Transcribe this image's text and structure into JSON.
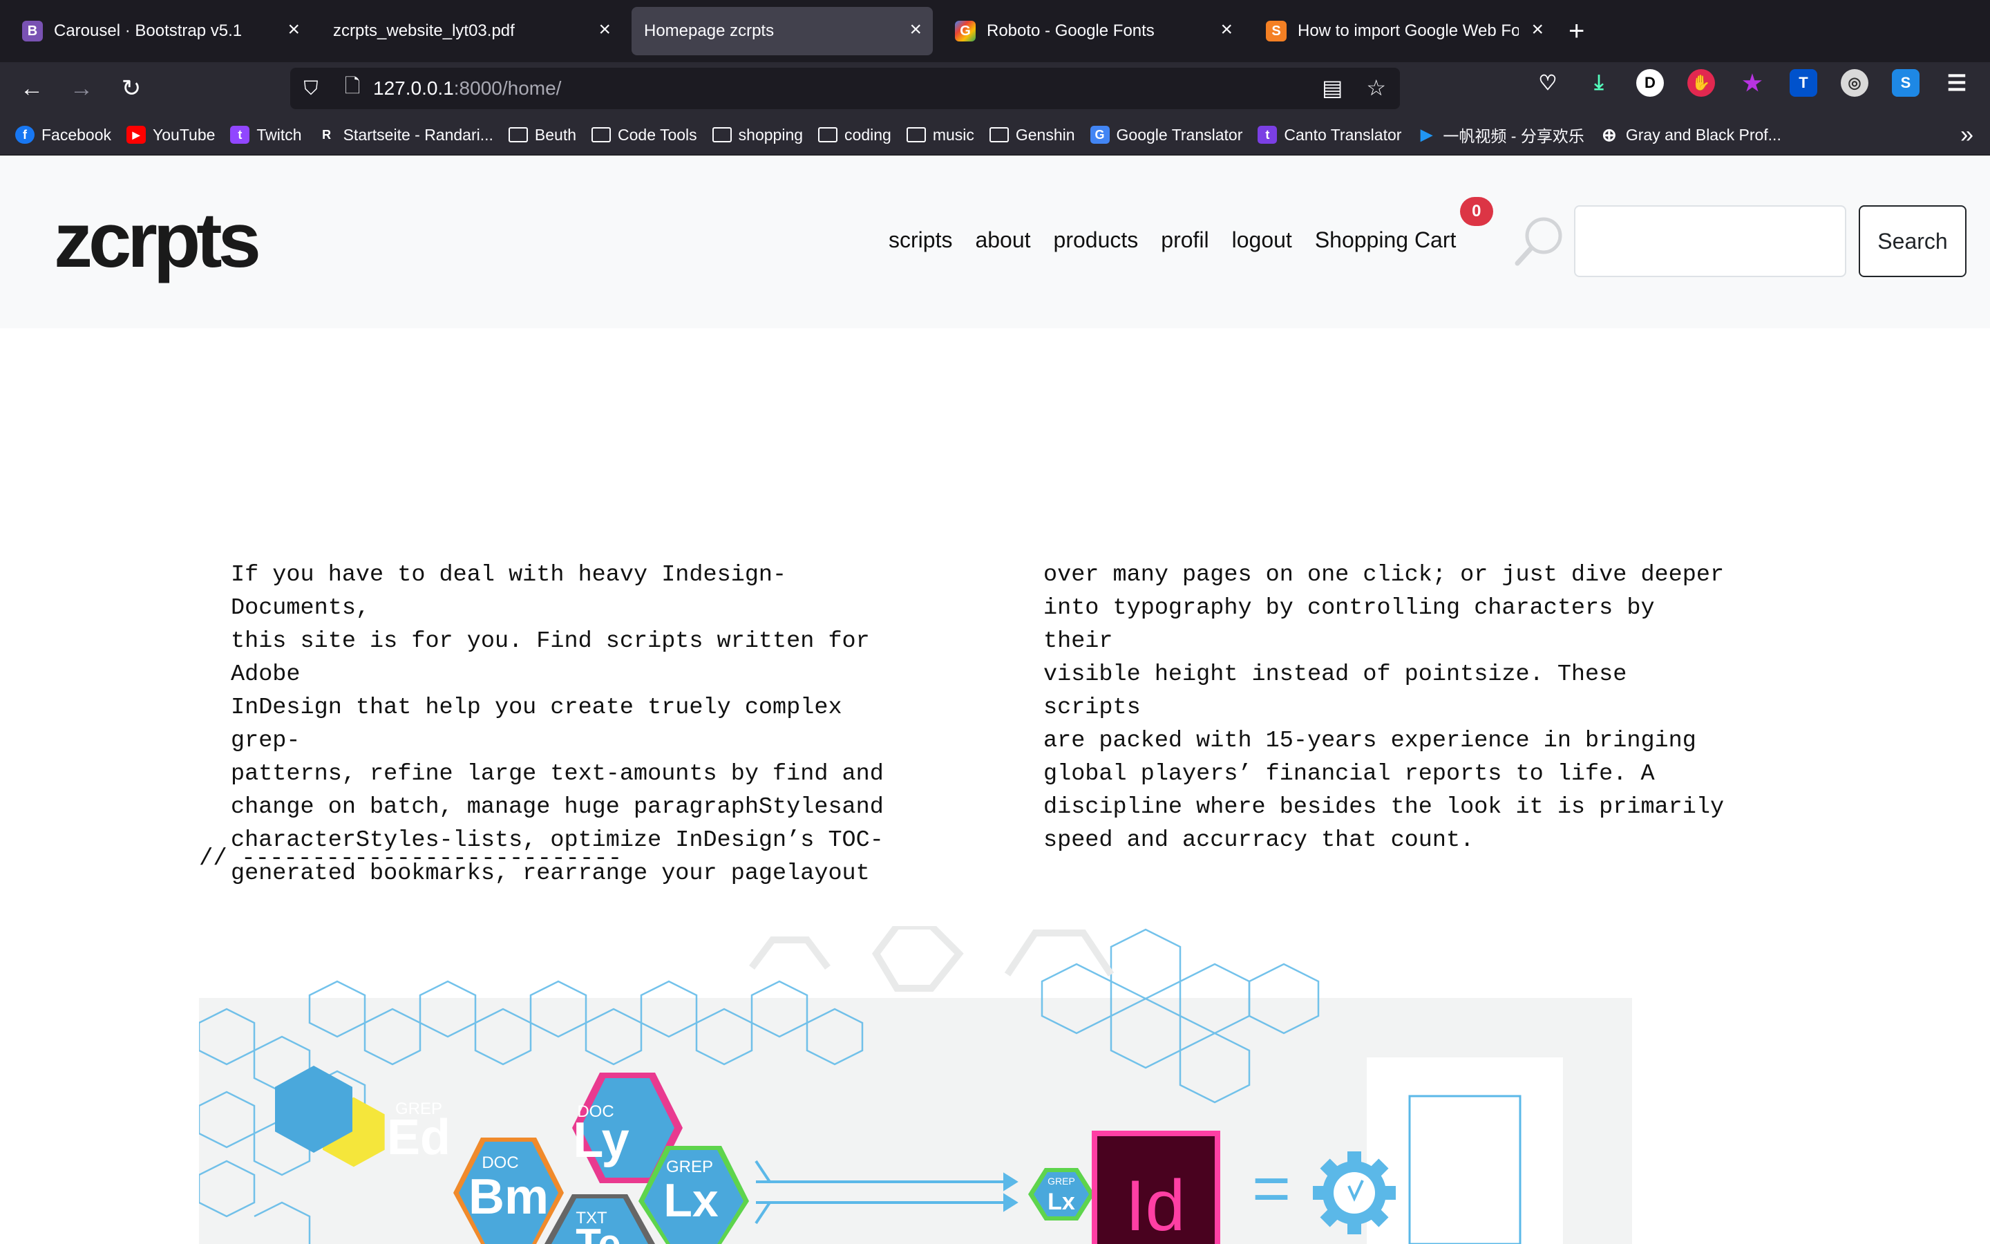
{
  "browser": {
    "tabs": [
      {
        "title": "Carousel · Bootstrap v5.1",
        "favicon": "B",
        "favicon_color": "#7952b3",
        "active": false
      },
      {
        "title": "zcrpts_website_lyt03.pdf",
        "favicon": "",
        "favicon_color": "",
        "active": false
      },
      {
        "title": "Homepage zcrpts",
        "favicon": "",
        "favicon_color": "",
        "active": true
      },
      {
        "title": "Roboto - Google Fonts",
        "favicon": "G",
        "favicon_color": "#4285f4",
        "active": false
      },
      {
        "title": "How to import Google Web Font",
        "favicon": "S",
        "favicon_color": "#f48024",
        "active": false
      }
    ],
    "url_host": "127.0.0.1",
    "url_rest": ":8000/home/",
    "bookmarks": [
      {
        "label": "Facebook",
        "type": "site",
        "icon": "f",
        "color": "#1877f2"
      },
      {
        "label": "YouTube",
        "type": "site",
        "icon": "▶",
        "color": "#ff0000"
      },
      {
        "label": "Twitch",
        "type": "site",
        "icon": "t",
        "color": "#9146ff"
      },
      {
        "label": "Startseite - Randari...",
        "type": "site",
        "icon": "R",
        "color": "#2b2a33"
      },
      {
        "label": "Beuth",
        "type": "folder"
      },
      {
        "label": "Code Tools",
        "type": "folder"
      },
      {
        "label": "shopping",
        "type": "folder"
      },
      {
        "label": "coding",
        "type": "folder"
      },
      {
        "label": "music",
        "type": "folder"
      },
      {
        "label": "Genshin",
        "type": "folder"
      },
      {
        "label": "Google Translator",
        "type": "site",
        "icon": "G",
        "color": "#4285f4"
      },
      {
        "label": "Canto Translator",
        "type": "site",
        "icon": "t",
        "color": "#7b3fe4"
      },
      {
        "label": "一帆视频 - 分享欢乐",
        "type": "site",
        "icon": "▶",
        "color": "#2196f3"
      },
      {
        "label": "Gray and Black Prof...",
        "type": "site",
        "icon": "⊕",
        "color": "#2b2a33"
      }
    ]
  },
  "site": {
    "logo": "zcrpts",
    "menu": [
      "scripts",
      "about",
      "products",
      "profil",
      "logout"
    ],
    "cart_label": "Shopping Cart",
    "cart_count": "0",
    "search_button": "Search",
    "search_value": ""
  },
  "intro": {
    "col1": "If you have to deal with heavy Indesign-Documents,\nthis site is for you. Find scripts written for Adobe\nInDesign that help you create truely complex grep-\npatterns, refine large text-amounts by find and\nchange on batch, manage huge paragraphStylesand\ncharacterStyles-lists, optimize InDesign’s TOC-\ngenerated bookmarks, rearrange your pagelayout",
    "col2": "over many pages on one click; or just dive deeper\ninto typography by controlling characters by their\nvisible height instead of pointsize. These scripts\nare packed with 15-years experience in bringing\nglobal players’ financial reports to life. A\ndiscipline where besides the look it is primarily\nspeed and accurracy that count."
  },
  "divider": "// ---------------------------",
  "hero": {
    "badges": [
      {
        "top": "GREP",
        "main": "Ed"
      },
      {
        "top": "DOC",
        "main": "Ly"
      },
      {
        "top": "DOC",
        "main": "Bm"
      },
      {
        "top": "GREP",
        "main": "Lx"
      },
      {
        "top": "TXT",
        "main": "Te"
      }
    ],
    "small_badge": {
      "top": "GREP",
      "main": "Lx"
    },
    "app_icon": "Id",
    "equals": "="
  }
}
